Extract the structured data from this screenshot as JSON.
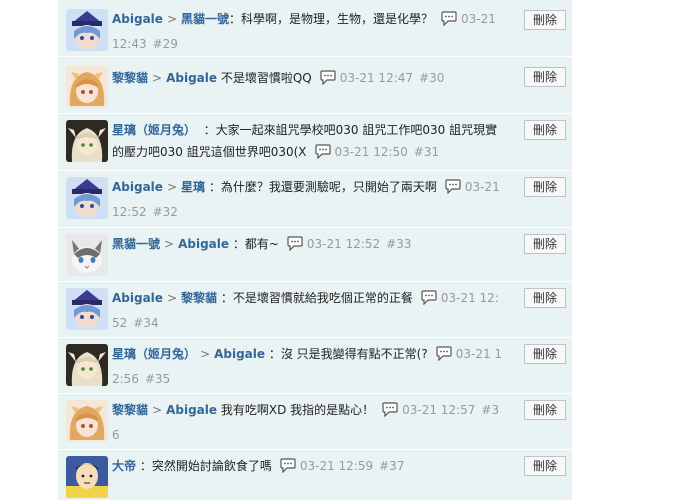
{
  "delete_label": "刪除",
  "comments": [
    {
      "avatar": "abigale-avatar",
      "author": "Abigale",
      "target": "黑貓一號",
      "text": "：科學啊，是物理，生物，還是化學？",
      "time": "03-21 12:43",
      "num": "#29"
    },
    {
      "avatar": "lilimao-avatar",
      "author": "黎黎貓",
      "target": "Abigale",
      "text": "不是壞習慣啦QQ",
      "time": "03-21 12:47",
      "num": "#30"
    },
    {
      "avatar": "xingli-avatar",
      "author": "星璃（姬月兔）",
      "target": "",
      "text": "：大家一起來詛咒學校吧030 詛咒工作吧030 詛咒現實的壓力吧030 詛咒這個世界吧030(X",
      "time": "03-21 12:50",
      "num": "#31"
    },
    {
      "avatar": "abigale-avatar",
      "author": "Abigale",
      "target": "星璃",
      "text": "：為什麼？我還要測驗呢，只開始了兩天啊",
      "time": "03-21 12:52",
      "num": "#32"
    },
    {
      "avatar": "cat-avatar",
      "author": "黑貓一號",
      "target": "Abigale",
      "text": "：都有~",
      "time": "03-21 12:52",
      "num": "#33"
    },
    {
      "avatar": "abigale-avatar",
      "author": "Abigale",
      "target": "黎黎貓",
      "text": "：不是壞習慣就給我吃個正常的正餐",
      "time": "03-21 12:52",
      "num": "#34"
    },
    {
      "avatar": "xingli-avatar",
      "author": "星璃（姬月兔）",
      "target": "Abigale",
      "text": "：沒 只是我變得有點不正常(?",
      "time": "03-21 12:56",
      "num": "#35"
    },
    {
      "avatar": "lilimao-avatar",
      "author": "黎黎貓",
      "target": "Abigale",
      "text": "我有吃啊XD 我指的是點心！",
      "time": "03-21 12:57",
      "num": "#36"
    },
    {
      "avatar": "dadi-avatar",
      "author": "大帝",
      "target": "",
      "text": "：突然開始討論飲食了嗎",
      "time": "03-21 12:59",
      "num": "#37"
    }
  ]
}
